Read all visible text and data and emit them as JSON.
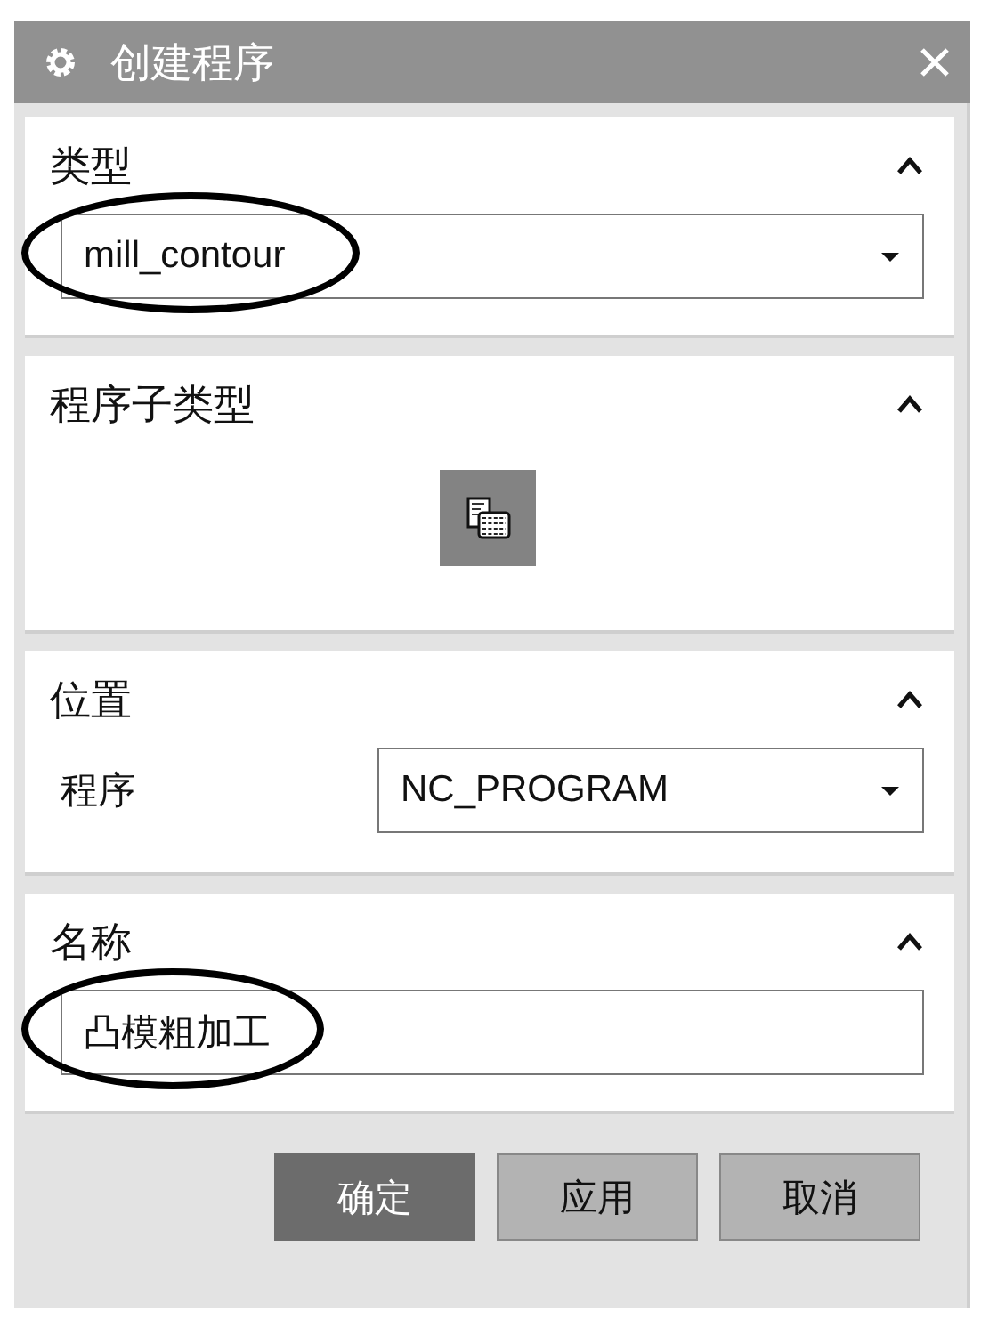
{
  "window": {
    "title": "创建程序"
  },
  "sections": [
    {
      "kind": "dropdown",
      "title": "类型",
      "expanded": true,
      "value": "mill_contour",
      "highlighted": true
    },
    {
      "kind": "icons",
      "title": "程序子类型",
      "expanded": true,
      "items": [
        {
          "selected": true
        }
      ]
    },
    {
      "kind": "labeled_dropdown",
      "title": "位置",
      "expanded": true,
      "label": "程序",
      "value": "NC_PROGRAM",
      "highlighted": false
    },
    {
      "kind": "text",
      "title": "名称",
      "expanded": true,
      "value": "凸模粗加工",
      "highlighted": true
    }
  ],
  "buttons": [
    {
      "label": "确定",
      "default": true
    },
    {
      "label": "应用",
      "default": false
    },
    {
      "label": "取消",
      "default": false
    }
  ]
}
